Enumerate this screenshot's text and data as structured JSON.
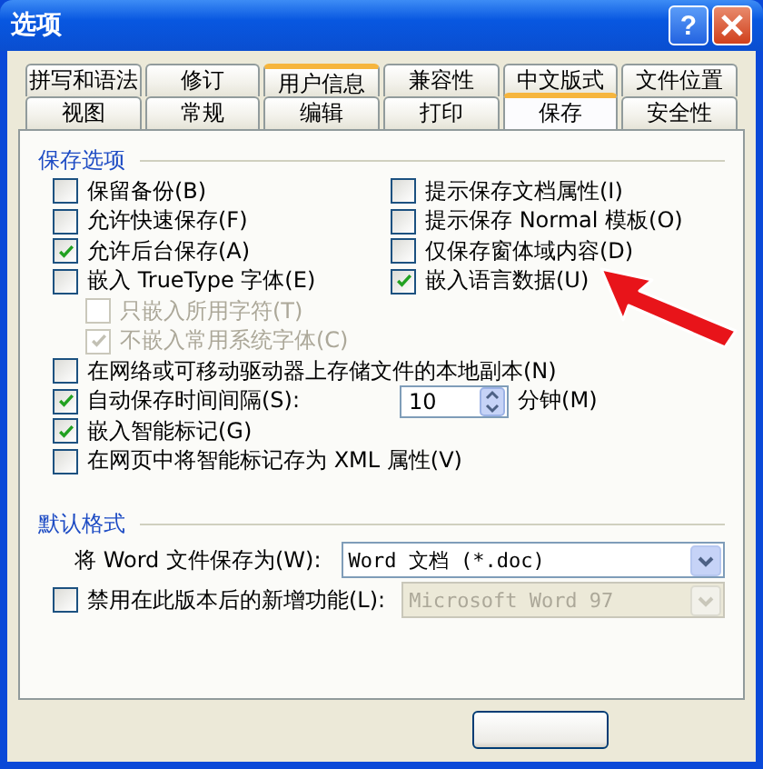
{
  "window": {
    "title": "选项",
    "help": "?"
  },
  "tabs_row1": [
    {
      "label": "拼写和语法",
      "selected": false,
      "hot": false
    },
    {
      "label": "修订",
      "selected": false,
      "hot": false
    },
    {
      "label": "用户信息",
      "selected": false,
      "hot": true
    },
    {
      "label": "兼容性",
      "selected": false,
      "hot": false
    },
    {
      "label": "中文版式",
      "selected": false,
      "hot": false
    },
    {
      "label": "文件位置",
      "selected": false,
      "hot": false
    }
  ],
  "tabs_row2": [
    {
      "label": "视图",
      "selected": false,
      "hot": false
    },
    {
      "label": "常规",
      "selected": false,
      "hot": false
    },
    {
      "label": "编辑",
      "selected": false,
      "hot": false
    },
    {
      "label": "打印",
      "selected": false,
      "hot": false
    },
    {
      "label": "保存",
      "selected": true,
      "hot": false
    },
    {
      "label": "安全性",
      "selected": false,
      "hot": false
    }
  ],
  "save_options": {
    "title": "保存选项",
    "left": [
      {
        "label": "保留备份(B)",
        "checked": false,
        "disabled": false
      },
      {
        "label": "允许快速保存(F)",
        "checked": false,
        "disabled": false
      },
      {
        "label": "允许后台保存(A)",
        "checked": true,
        "disabled": false
      },
      {
        "label": "嵌入 TrueType 字体(E)",
        "checked": false,
        "disabled": false,
        "children": [
          {
            "label": "只嵌入所用字符(T)",
            "checked": false,
            "disabled": true
          },
          {
            "label": "不嵌入常用系统字体(C)",
            "checked": true,
            "disabled": true
          }
        ]
      }
    ],
    "right": [
      {
        "label": "提示保存文档属性(I)",
        "checked": false,
        "disabled": false
      },
      {
        "label": "提示保存 Normal 模板(O)",
        "checked": false,
        "disabled": false
      },
      {
        "label": "仅保存窗体域内容(D)",
        "checked": false,
        "disabled": false
      },
      {
        "label": "嵌入语言数据(U)",
        "checked": true,
        "disabled": false
      }
    ],
    "rows": [
      {
        "kind": "check",
        "label": "在网络或可移动驱动器上存储文件的本地副本(N)",
        "checked": false
      },
      {
        "kind": "spin",
        "label": "自动保存时间间隔(S):",
        "checked": true,
        "value": "10",
        "unit": "分钟(M)"
      },
      {
        "kind": "check",
        "label": "嵌入智能标记(G)",
        "checked": true
      },
      {
        "kind": "check",
        "label": "在网页中将智能标记存为 XML 属性(V)",
        "checked": false
      }
    ]
  },
  "default_format": {
    "title": "默认格式",
    "save_as": {
      "label": "将 Word 文件保存为(W):",
      "value": "Word 文档 (*.doc)"
    },
    "disable_features": {
      "label": "禁用在此版本后的新增功能(L):",
      "checked": false,
      "value": "Microsoft Word 97",
      "disabled": true
    }
  }
}
